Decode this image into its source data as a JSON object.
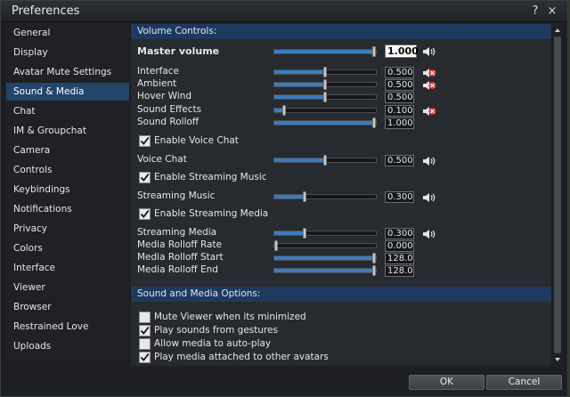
{
  "window": {
    "title": "Preferences",
    "help_icon": "?",
    "close_icon": "×"
  },
  "sidebar": {
    "items": [
      {
        "label": "General"
      },
      {
        "label": "Display"
      },
      {
        "label": "Avatar Mute Settings"
      },
      {
        "label": "Sound & Media"
      },
      {
        "label": "Chat"
      },
      {
        "label": "IM & Groupchat"
      },
      {
        "label": "Camera"
      },
      {
        "label": "Controls"
      },
      {
        "label": "Keybindings"
      },
      {
        "label": "Notifications"
      },
      {
        "label": "Privacy"
      },
      {
        "label": "Colors"
      },
      {
        "label": "Interface"
      },
      {
        "label": "Viewer"
      },
      {
        "label": "Browser"
      },
      {
        "label": "Restrained Love"
      },
      {
        "label": "Uploads"
      }
    ],
    "selected": "Sound & Media"
  },
  "volume": {
    "header": "Volume Controls:",
    "master": {
      "label": "Master volume",
      "value": "1.000",
      "level": 1.0
    },
    "interface": {
      "label": "Interface",
      "value": "0.500",
      "level": 0.5,
      "muted": true
    },
    "ambient": {
      "label": "Ambient",
      "value": "0.500",
      "level": 0.5,
      "muted": true
    },
    "hover_wind": {
      "label": "Hover Wind",
      "value": "0.500",
      "level": 0.5
    },
    "sound_effects": {
      "label": "Sound Effects",
      "value": "0.100",
      "level": 0.1,
      "muted": true
    },
    "sound_rolloff": {
      "label": "Sound Rolloff",
      "value": "1.000",
      "level": 1.0
    },
    "enable_voice": {
      "label": "Enable Voice Chat",
      "checked": true
    },
    "voice_chat": {
      "label": "Voice Chat",
      "value": "0.500",
      "level": 0.5
    },
    "enable_streaming_music": {
      "label": "Enable Streaming Music",
      "checked": true
    },
    "streaming_music": {
      "label": "Streaming Music",
      "value": "0.300",
      "level": 0.3
    },
    "enable_streaming_media": {
      "label": "Enable Streaming Media",
      "checked": true
    },
    "streaming_media": {
      "label": "Streaming Media",
      "value": "0.300",
      "level": 0.3
    },
    "media_rolloff_rate": {
      "label": "Media Rolloff Rate",
      "value": "0.000",
      "level": 0.0
    },
    "media_rolloff_start": {
      "label": "Media Rolloff Start",
      "value": "128.0",
      "level": 1.0
    },
    "media_rolloff_end": {
      "label": "Media Rolloff End",
      "value": "128.0",
      "level": 1.0
    }
  },
  "options": {
    "header": "Sound and Media Options:",
    "mute_minimized": {
      "label": "Mute Viewer when its minimized",
      "checked": false
    },
    "play_gestures": {
      "label": "Play sounds from gestures",
      "checked": true
    },
    "auto_play": {
      "label": "Allow media to auto-play",
      "checked": false
    },
    "play_attached": {
      "label": "Play media attached to other avatars",
      "checked": true
    }
  },
  "buttons": {
    "ok": "OK",
    "cancel": "Cancel"
  },
  "colors": {
    "accent": "#3a7bbf",
    "selection": "#22456a",
    "header": "#1d3a5e",
    "muted": "#d23a3a"
  }
}
